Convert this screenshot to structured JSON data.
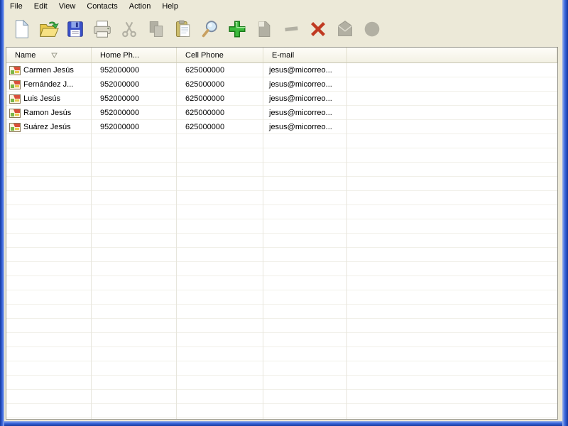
{
  "menu": {
    "items": [
      {
        "label": "File"
      },
      {
        "label": "Edit"
      },
      {
        "label": "View"
      },
      {
        "label": "Contacts"
      },
      {
        "label": "Action"
      },
      {
        "label": "Help"
      }
    ]
  },
  "toolbar": {
    "buttons": [
      {
        "name": "new",
        "icon": "new-document-icon",
        "enabled": true
      },
      {
        "name": "open",
        "icon": "open-folder-icon",
        "enabled": true
      },
      {
        "name": "save",
        "icon": "save-floppy-icon",
        "enabled": true
      },
      {
        "name": "print",
        "icon": "printer-icon",
        "enabled": true
      },
      {
        "name": "cut",
        "icon": "scissors-icon",
        "enabled": false
      },
      {
        "name": "copy",
        "icon": "copy-pages-icon",
        "enabled": false
      },
      {
        "name": "paste",
        "icon": "clipboard-icon",
        "enabled": true
      },
      {
        "name": "find",
        "icon": "magnifier-icon",
        "enabled": true
      },
      {
        "name": "add-contact",
        "icon": "green-plus-icon",
        "enabled": true
      },
      {
        "name": "edit-contact",
        "icon": "gray-page-icon",
        "enabled": false
      },
      {
        "name": "remove-contact",
        "icon": "gray-minus-icon",
        "enabled": false
      },
      {
        "name": "delete",
        "icon": "red-x-icon",
        "enabled": true
      },
      {
        "name": "send-mail",
        "icon": "envelope-icon",
        "enabled": false
      },
      {
        "name": "web",
        "icon": "gray-ball-icon",
        "enabled": false
      }
    ]
  },
  "table": {
    "columns": [
      {
        "key": "name",
        "label": "Name",
        "width": 120,
        "sort": "desc"
      },
      {
        "key": "home_phone",
        "label": "Home Ph...",
        "width": 120,
        "sort": ""
      },
      {
        "key": "cell_phone",
        "label": "Cell Phone",
        "width": 122,
        "sort": ""
      },
      {
        "key": "email",
        "label": "E-mail",
        "width": 118,
        "sort": ""
      }
    ],
    "rows": [
      {
        "name": "Carmen Jesús",
        "home_phone": "952000000",
        "cell_phone": "625000000",
        "email": "jesus@micorreo..."
      },
      {
        "name": "Fernández J...",
        "home_phone": "952000000",
        "cell_phone": "625000000",
        "email": "jesus@micorreo..."
      },
      {
        "name": "Luis Jesús",
        "home_phone": "952000000",
        "cell_phone": "625000000",
        "email": "jesus@micorreo..."
      },
      {
        "name": "Ramon Jesús",
        "home_phone": "952000000",
        "cell_phone": "625000000",
        "email": "jesus@micorreo..."
      },
      {
        "name": "Suárez Jesús",
        "home_phone": "952000000",
        "cell_phone": "625000000",
        "email": "jesus@micorreo..."
      }
    ],
    "row_icon": "contact-card-icon"
  },
  "colors": {
    "chrome_bg": "#ece9d8",
    "frame_blue": "#3a67dd",
    "add_green": "#3dbb3d",
    "delete_red": "#c03a22",
    "grid_line": "#e7e5dc",
    "header_border": "#c8c5b4"
  }
}
